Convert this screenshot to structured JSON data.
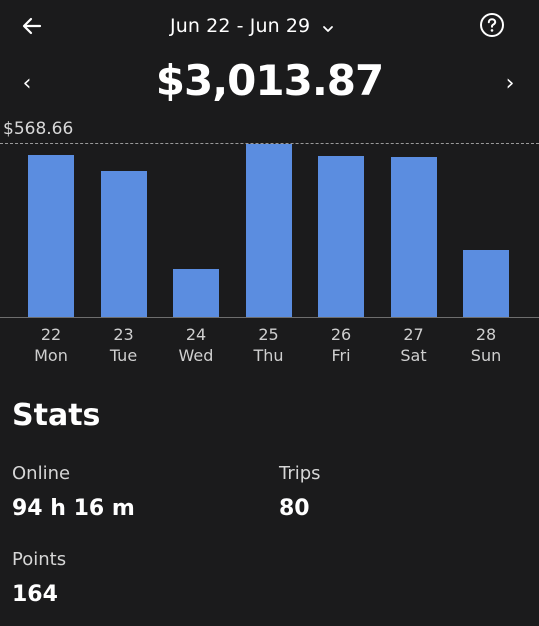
{
  "header": {
    "date_range": "Jun 22 - Jun 29",
    "back_icon": "arrow-left-icon",
    "help_icon": "question-circle-icon",
    "dropdown_icon": "chevron-down-icon"
  },
  "summary": {
    "total": "$3,013.87",
    "prev_symbol": "‹",
    "next_symbol": "›"
  },
  "colors": {
    "background": "#1b1b1c",
    "bar": "#5b8de0"
  },
  "chart_data": {
    "type": "bar",
    "max_label": "$568.66",
    "ylim": [
      0,
      568.66
    ],
    "categories": [
      {
        "day": "22",
        "weekday": "Mon"
      },
      {
        "day": "23",
        "weekday": "Tue"
      },
      {
        "day": "24",
        "weekday": "Wed"
      },
      {
        "day": "25",
        "weekday": "Thu"
      },
      {
        "day": "26",
        "weekday": "Fri"
      },
      {
        "day": "27",
        "weekday": "Sat"
      },
      {
        "day": "28",
        "weekday": "Sun"
      }
    ],
    "values": [
      532,
      480,
      160,
      568.66,
      530,
      525,
      222
    ]
  },
  "stats": {
    "title": "Stats",
    "online_label": "Online",
    "online_value": "94 h 16 m",
    "trips_label": "Trips",
    "trips_value": "80",
    "points_label": "Points",
    "points_value": "164"
  }
}
